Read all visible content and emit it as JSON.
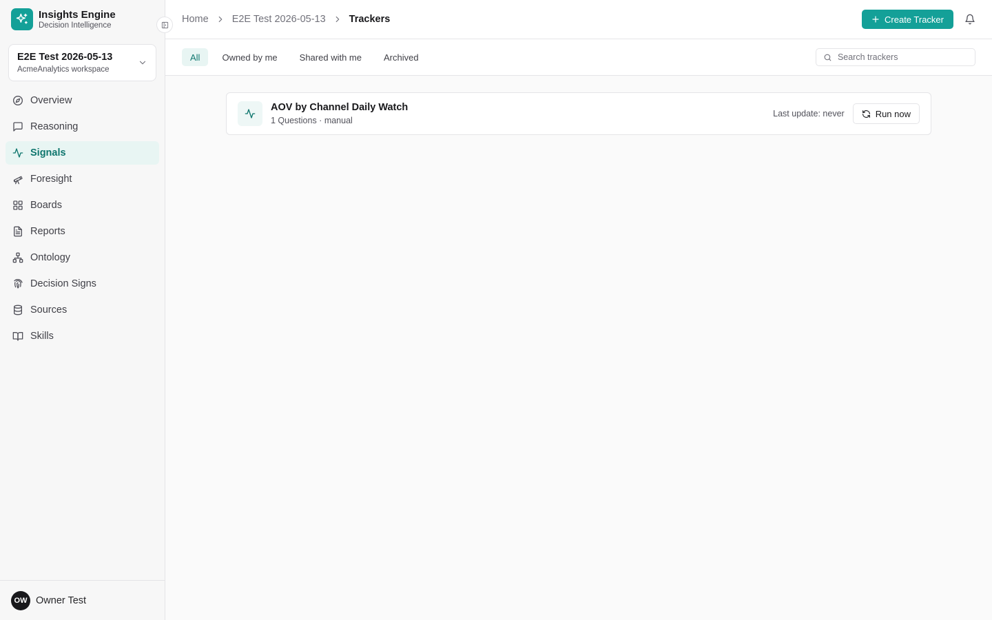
{
  "brand": {
    "name": "Insights Engine",
    "subtitle": "Decision Intelligence",
    "accent": "#14a098"
  },
  "workspace": {
    "name": "E2E Test 2026-05-13",
    "subtitle": "AcmeAnalytics workspace"
  },
  "sidebar": {
    "items": [
      {
        "label": "Overview",
        "icon": "compass-icon",
        "active": false
      },
      {
        "label": "Reasoning",
        "icon": "message-square-icon",
        "active": false
      },
      {
        "label": "Signals",
        "icon": "activity-icon",
        "active": true
      },
      {
        "label": "Foresight",
        "icon": "telescope-icon",
        "active": false
      },
      {
        "label": "Boards",
        "icon": "grid-icon",
        "active": false
      },
      {
        "label": "Reports",
        "icon": "file-text-icon",
        "active": false
      },
      {
        "label": "Ontology",
        "icon": "network-icon",
        "active": false
      },
      {
        "label": "Decision Signs",
        "icon": "fingerprint-icon",
        "active": false
      },
      {
        "label": "Sources",
        "icon": "database-icon",
        "active": false
      },
      {
        "label": "Skills",
        "icon": "book-open-icon",
        "active": false
      }
    ]
  },
  "user": {
    "initials": "OW",
    "name": "Owner Test"
  },
  "breadcrumb": {
    "home": "Home",
    "workspace": "E2E Test 2026-05-13",
    "current": "Trackers"
  },
  "header": {
    "create_label": "Create Tracker"
  },
  "tabs": [
    {
      "label": "All",
      "active": true
    },
    {
      "label": "Owned by me",
      "active": false
    },
    {
      "label": "Shared with me",
      "active": false
    },
    {
      "label": "Archived",
      "active": false
    }
  ],
  "search": {
    "placeholder": "Search trackers",
    "value": ""
  },
  "trackers": [
    {
      "name": "AOV by Channel Daily Watch",
      "meta": "1 Questions · manual",
      "last_update": "Last update: never",
      "run_label": "Run now"
    }
  ]
}
